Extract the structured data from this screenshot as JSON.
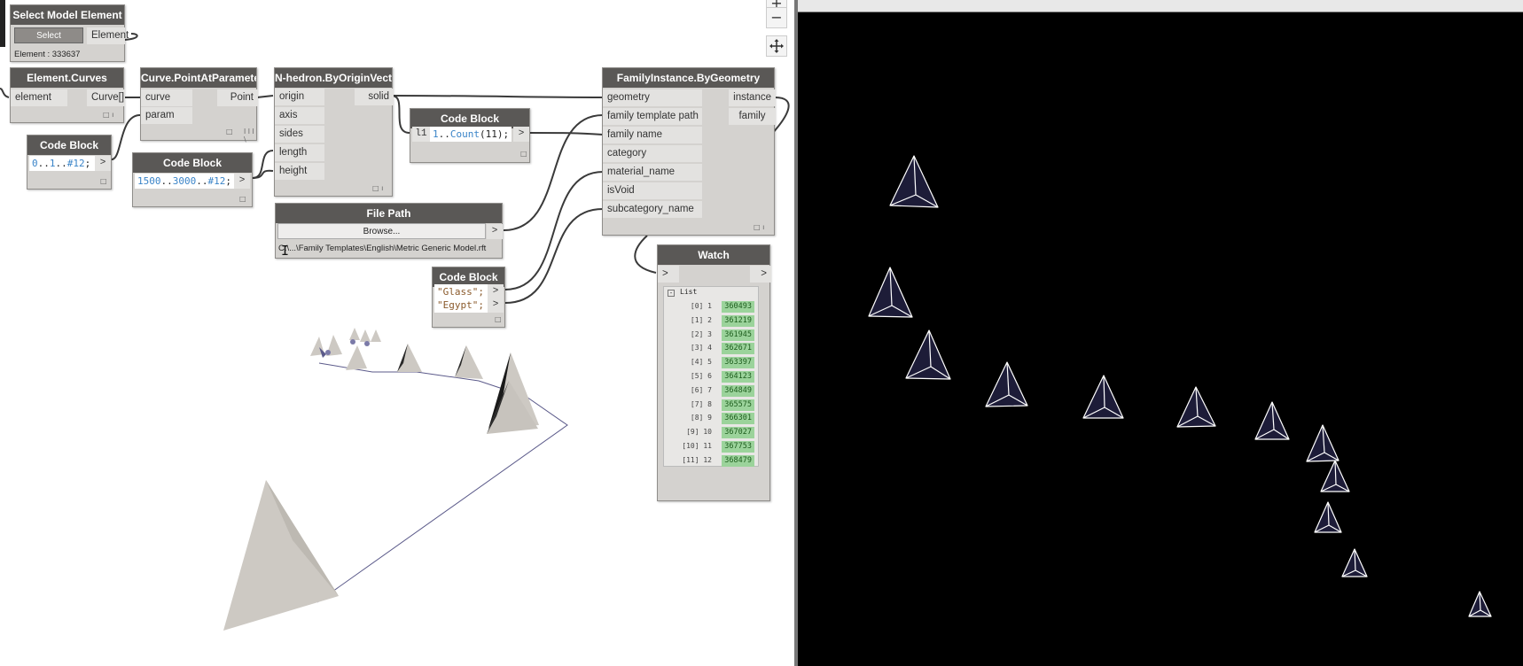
{
  "colors": {
    "node_header": "#5a5856",
    "node_body": "#d4d2cf",
    "watch_value_bg": "#9bd39b",
    "wire": "#3a3a3a",
    "viewport_bg": "#000000",
    "canvas_bg": "#ffffff"
  },
  "canvas": {
    "zoom_in": "+",
    "zoom_out": "−",
    "pan_icon": "move-icon"
  },
  "nodes": {
    "select_model_element": {
      "title": "Select Model Element",
      "select_label": "Select",
      "output": "Element",
      "info": "Element : 333637"
    },
    "element_curves": {
      "title": "Element.Curves",
      "input": "element",
      "output": "Curve[]"
    },
    "curve_point_at_parameter": {
      "title": "Curve.PointAtParameter",
      "inputs": [
        "curve",
        "param"
      ],
      "output": "Point",
      "foot": "l l l \\"
    },
    "code_block_1": {
      "title": "Code Block",
      "code": [
        "0",
        "..",
        "1",
        "..",
        "#12",
        ";"
      ],
      "output": ">"
    },
    "code_block_2": {
      "title": "Code Block",
      "code": [
        "1500",
        "..",
        "3000",
        "..",
        "#12",
        ";"
      ],
      "output": ">"
    },
    "nhedron": {
      "title": "N-hedron.ByOriginVector",
      "inputs": [
        "origin",
        "axis",
        "sides",
        "length",
        "height"
      ],
      "output": "solid"
    },
    "code_block_3": {
      "title": "Code Block",
      "prefix": "l1",
      "code": [
        "1",
        "..",
        "Count",
        "(11);"
      ],
      "output": ">"
    },
    "file_path": {
      "title": "File Path",
      "browse_label": "Browse...",
      "output": ">",
      "path": "C:\\...\\Family Templates\\English\\Metric Generic Model.rft"
    },
    "code_block_4": {
      "title": "Code Block",
      "lines": [
        "\"Glass\";",
        "\"Egypt\";"
      ],
      "output": ">"
    },
    "family_instance": {
      "title": "FamilyInstance.ByGeometry",
      "inputs": [
        "geometry",
        "family template path",
        "family name",
        "category",
        "material_name",
        "isVoid",
        "subcategory_name"
      ],
      "outputs": [
        "instance",
        "family"
      ]
    },
    "watch": {
      "title": "Watch",
      "input": ">",
      "output": ">",
      "list_label": "List",
      "rows": [
        {
          "index": "[0] 1",
          "value": "360493"
        },
        {
          "index": "[1] 2",
          "value": "361219"
        },
        {
          "index": "[2] 3",
          "value": "361945"
        },
        {
          "index": "[3] 4",
          "value": "362671"
        },
        {
          "index": "[4] 5",
          "value": "363397"
        },
        {
          "index": "[5] 6",
          "value": "364123"
        },
        {
          "index": "[6] 7",
          "value": "364849"
        },
        {
          "index": "[7] 8",
          "value": "365575"
        },
        {
          "index": "[8] 9",
          "value": "366301"
        },
        {
          "index": "[9] 10",
          "value": "367027"
        },
        {
          "index": "[10] 11",
          "value": "367753"
        },
        {
          "index": "[11] 12",
          "value": "368479"
        }
      ]
    }
  }
}
